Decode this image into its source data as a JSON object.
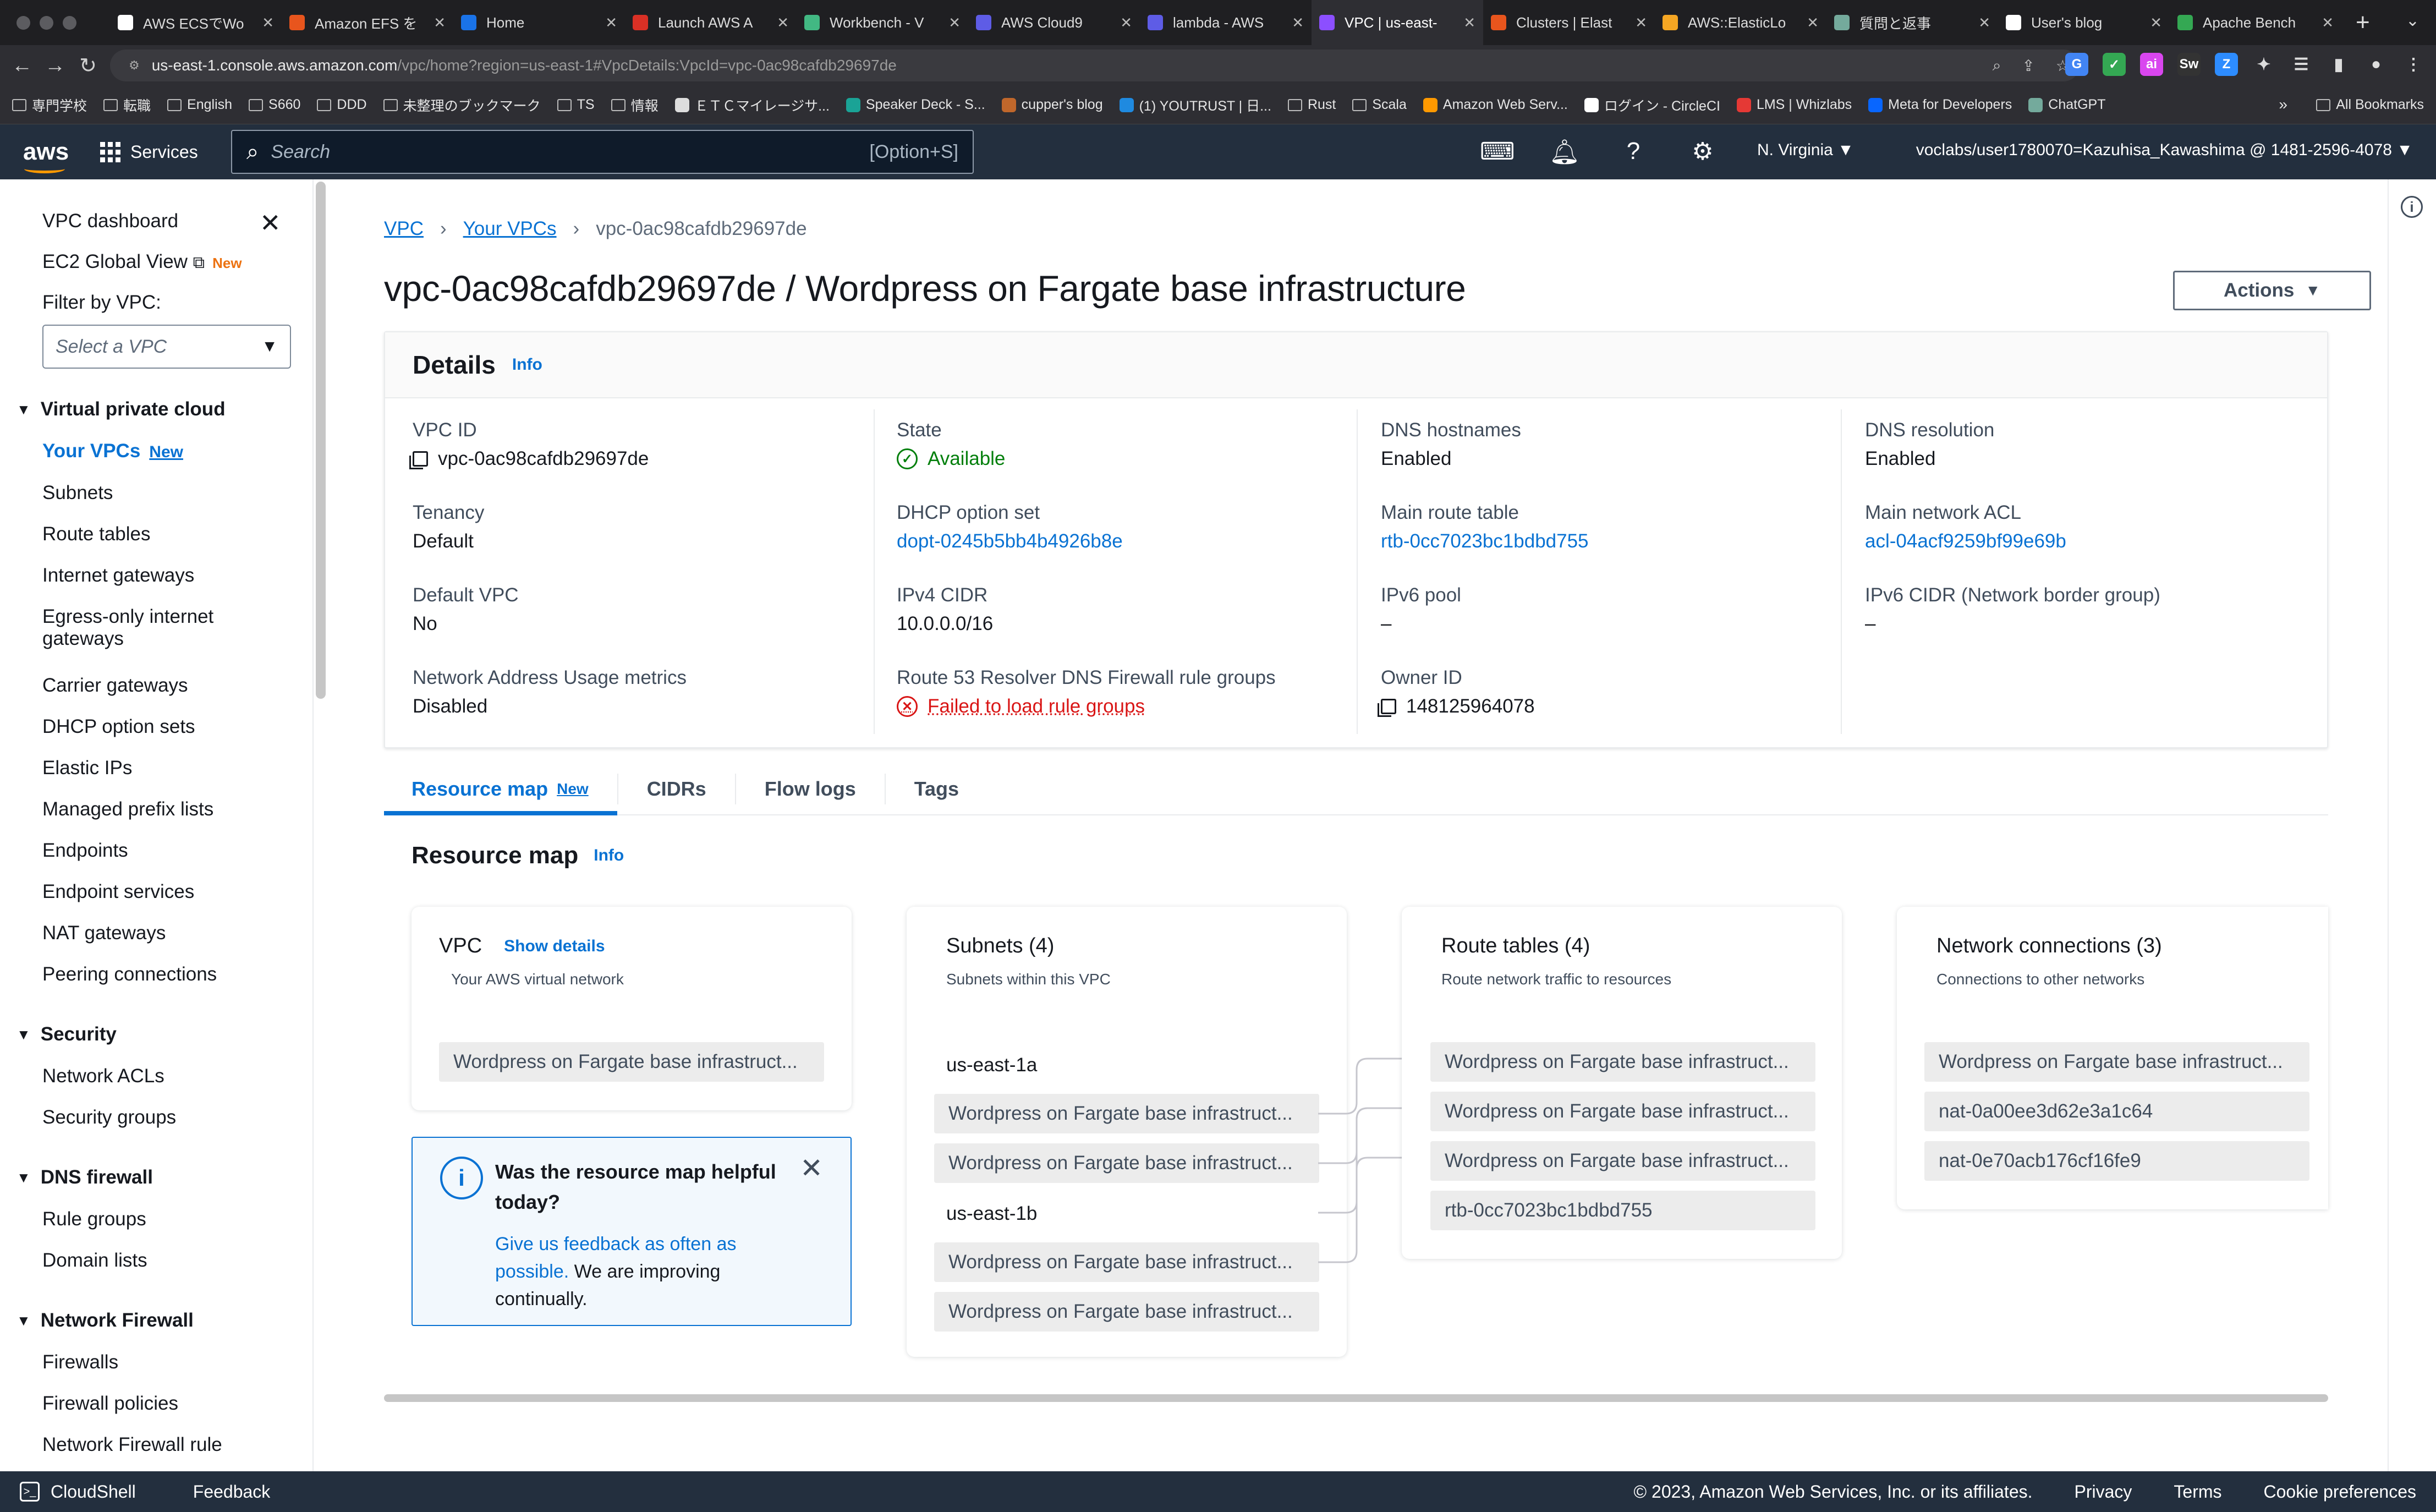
{
  "browser": {
    "tabs": [
      {
        "label": "AWS ECSでWo",
        "color": "#ffffff"
      },
      {
        "label": "Amazon EFS を",
        "color": "#e8551d"
      },
      {
        "label": "Home",
        "color": "#1a73e8"
      },
      {
        "label": "Launch AWS A",
        "color": "#d93025"
      },
      {
        "label": "Workbench - V",
        "color": "#42b883"
      },
      {
        "label": "AWS Cloud9",
        "color": "#5e5ce6"
      },
      {
        "label": "lambda - AWS",
        "color": "#5e5ce6"
      },
      {
        "label": "VPC | us-east-",
        "color": "#8c4fff"
      },
      {
        "label": "Clusters | Elast",
        "color": "#e8551d"
      },
      {
        "label": "AWS::ElasticLo",
        "color": "#f5a623"
      },
      {
        "label": "質問と返事",
        "color": "#74aa9c"
      },
      {
        "label": "User's blog",
        "color": "#ffffff"
      },
      {
        "label": "Apache Bench",
        "color": "#34a853"
      }
    ],
    "url_host": "us-east-1.console.aws.amazon.com",
    "url_path": "/vpc/home?region=us-east-1#VpcDetails:VpcId=vpc-0ac98cafdb29697de",
    "extensions": [
      {
        "label": "G",
        "color": "#4285f4"
      },
      {
        "label": "✓",
        "color": "#34a853"
      },
      {
        "label": "ai",
        "color": "#d946ef"
      },
      {
        "label": "Sw",
        "color": "#333"
      },
      {
        "label": "Z",
        "color": "#2d8cff"
      }
    ],
    "bookmarks": [
      {
        "label": "専門学校",
        "kind": "folder"
      },
      {
        "label": "転職",
        "kind": "folder"
      },
      {
        "label": "English",
        "kind": "folder"
      },
      {
        "label": "S660",
        "kind": "folder"
      },
      {
        "label": "DDD",
        "kind": "folder"
      },
      {
        "label": "未整理のブックマーク",
        "kind": "folder"
      },
      {
        "label": "TS",
        "kind": "folder"
      },
      {
        "label": "情報",
        "kind": "folder"
      },
      {
        "label": "ＥＴＣマイレージサ...",
        "kind": "site",
        "color": "#ddd"
      },
      {
        "label": "Speaker Deck - S...",
        "kind": "site",
        "color": "#1aa396"
      },
      {
        "label": "cupper's blog",
        "kind": "site",
        "color": "#c0672b"
      },
      {
        "label": "(1) YOUTRUST | 日...",
        "kind": "site",
        "color": "#1f8ae0"
      },
      {
        "label": "Rust",
        "kind": "folder"
      },
      {
        "label": "Scala",
        "kind": "folder"
      },
      {
        "label": "Amazon Web Serv...",
        "kind": "site",
        "color": "#ff9900"
      },
      {
        "label": "ログイン - CircleCI",
        "kind": "site",
        "color": "#ffffff"
      },
      {
        "label": "LMS | Whizlabs",
        "kind": "site",
        "color": "#e53935"
      },
      {
        "label": "Meta for Developers",
        "kind": "site",
        "color": "#0866ff"
      },
      {
        "label": "ChatGPT",
        "kind": "site",
        "color": "#74aa9c"
      }
    ],
    "bookmarks_more": "»",
    "all_bookmarks": "All Bookmarks"
  },
  "awsnav": {
    "logo": "aws",
    "services": "Services",
    "search_placeholder": "Search",
    "search_hint": "[Option+S]",
    "region": "N. Virginia ▼",
    "account": "voclabs/user1780070=Kazuhisa_Kawashima @ 1481-2596-4078 ▼"
  },
  "sidebar": {
    "dashboard": "VPC dashboard",
    "global_view": "EC2 Global View",
    "global_new": "New",
    "filter_label": "Filter by VPC:",
    "filter_placeholder": "Select a VPC",
    "sections": {
      "vpc_head": "Virtual private cloud",
      "your_vpcs": "Your VPCs",
      "your_vpcs_new": "New",
      "subnets": "Subnets",
      "route_tables": "Route tables",
      "igw": "Internet gateways",
      "egress1": "Egress-only internet",
      "egress2": "gateways",
      "carrier": "Carrier gateways",
      "dhcp": "DHCP option sets",
      "eip": "Elastic IPs",
      "prefix": "Managed prefix lists",
      "endpoints": "Endpoints",
      "endpoint_services": "Endpoint services",
      "nat": "NAT gateways",
      "peering": "Peering connections",
      "security_head": "Security",
      "nacl": "Network ACLs",
      "sg": "Security groups",
      "dnsfw_head": "DNS firewall",
      "rule_groups": "Rule groups",
      "domain_lists": "Domain lists",
      "nfw_head": "Network Firewall",
      "firewalls": "Firewalls",
      "fw_policies": "Firewall policies",
      "nfw_rule": "Network Firewall rule"
    }
  },
  "page": {
    "crumb_vpc": "VPC",
    "crumb_your_vpcs": "Your VPCs",
    "crumb_current": "vpc-0ac98cafdb29697de",
    "title": "vpc-0ac98cafdb29697de / Wordpress on Fargate base infrastructure",
    "actions": "Actions"
  },
  "details": {
    "heading": "Details",
    "info": "Info",
    "vpc_id_label": "VPC ID",
    "vpc_id": "vpc-0ac98cafdb29697de",
    "tenancy_label": "Tenancy",
    "tenancy": "Default",
    "default_vpc_label": "Default VPC",
    "default_vpc": "No",
    "nau_label": "Network Address Usage metrics",
    "nau": "Disabled",
    "state_label": "State",
    "state": "Available",
    "dhcp_label": "DHCP option set",
    "dhcp": "dopt-0245b5bb4b4926b8e",
    "ipv4_label": "IPv4 CIDR",
    "ipv4": "10.0.0.0/16",
    "r53_label": "Route 53 Resolver DNS Firewall rule groups",
    "r53": "Failed to load rule groups",
    "dns_host_label": "DNS hostnames",
    "dns_host": "Enabled",
    "main_rt_label": "Main route table",
    "main_rt": "rtb-0cc7023bc1bdbd755",
    "ipv6pool_label": "IPv6 pool",
    "ipv6pool": "–",
    "owner_label": "Owner ID",
    "owner": "148125964078",
    "dns_res_label": "DNS resolution",
    "dns_res": "Enabled",
    "main_acl_label": "Main network ACL",
    "main_acl": "acl-04acf9259bf99e69b",
    "ipv6cidr_label": "IPv6 CIDR (Network border group)",
    "ipv6cidr": "–"
  },
  "tabs": {
    "resource_map": "Resource map",
    "resource_map_new": "New",
    "cidrs": "CIDRs",
    "flow_logs": "Flow logs",
    "tags": "Tags"
  },
  "resmap": {
    "heading": "Resource map",
    "info": "Info",
    "vpc_title": "VPC",
    "vpc_show": "Show details",
    "vpc_sub": "Your AWS virtual network",
    "vpc_item": "Wordpress on Fargate base infrastruct...",
    "subnets_title": "Subnets (4)",
    "subnets_sub": "Subnets within this VPC",
    "az1": "us-east-1a",
    "az2": "us-east-1b",
    "subnet_items": [
      "Wordpress on Fargate base infrastruct...",
      "Wordpress on Fargate base infrastruct...",
      "Wordpress on Fargate base infrastruct...",
      "Wordpress on Fargate base infrastruct..."
    ],
    "rt_title": "Route tables (4)",
    "rt_sub": "Route network traffic to resources",
    "rt_items": [
      "Wordpress on Fargate base infrastruct...",
      "Wordpress on Fargate base infrastruct...",
      "Wordpress on Fargate base infrastruct...",
      "rtb-0cc7023bc1bdbd755"
    ],
    "nc_title": "Network connections (3)",
    "nc_sub": "Connections to other networks",
    "nc_items": [
      "Wordpress on Fargate base infrastruct...",
      "nat-0a00ee3d62e3a1c64",
      "nat-0e70acb176cf16fe9"
    ],
    "feedback_q": "Was the resource map helpful today?",
    "feedback_link": "Give us feedback as often as possible.",
    "feedback_rest": " We are improving continually."
  },
  "footer": {
    "cloudshell": "CloudShell",
    "feedback": "Feedback",
    "copyright": "© 2023, Amazon Web Services, Inc. or its affiliates.",
    "privacy": "Privacy",
    "terms": "Terms",
    "cookies": "Cookie preferences"
  },
  "colors": {
    "aws_nav": "#232f3e",
    "link": "#0972d3",
    "success": "#037f0c",
    "error": "#d91515",
    "accent": "#ff9900"
  }
}
